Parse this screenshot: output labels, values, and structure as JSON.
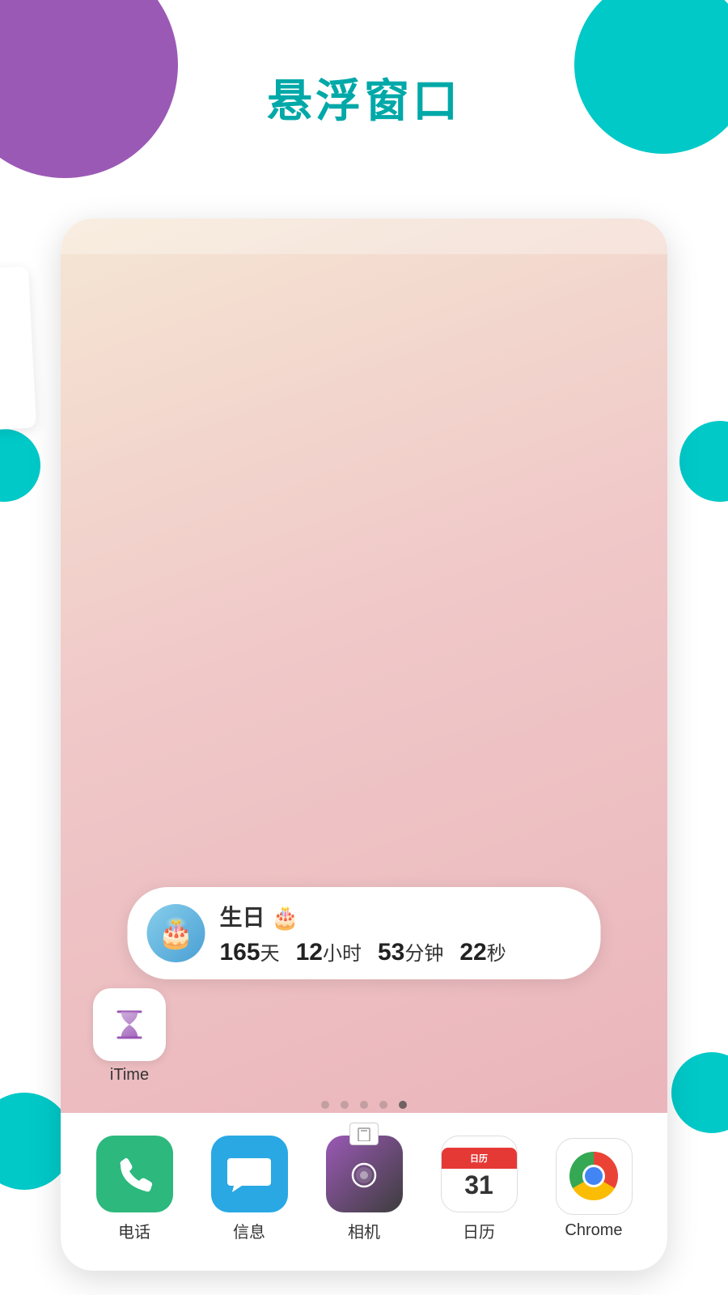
{
  "page": {
    "title": "悬浮窗口",
    "background": {
      "purple": "#9b59b6",
      "teal": "#00c9c8"
    }
  },
  "birthday_widget": {
    "title": "生日 🎂",
    "days": "165天",
    "days_num": "165",
    "hours_num": "12",
    "minutes_num": "53",
    "seconds_num": "22",
    "countdown_text": "165天  12小时  53分钟  22秒",
    "avatar_emoji": "🎂"
  },
  "itime_app": {
    "label": "iTime"
  },
  "page_dots": {
    "total": 5,
    "active_index": 4
  },
  "dock": {
    "apps": [
      {
        "label": "电话",
        "type": "phone"
      },
      {
        "label": "信息",
        "type": "messages"
      },
      {
        "label": "相机",
        "type": "camera"
      },
      {
        "label": "日历",
        "type": "calendar",
        "date": "31"
      },
      {
        "label": "Chrome",
        "type": "chrome"
      }
    ]
  }
}
